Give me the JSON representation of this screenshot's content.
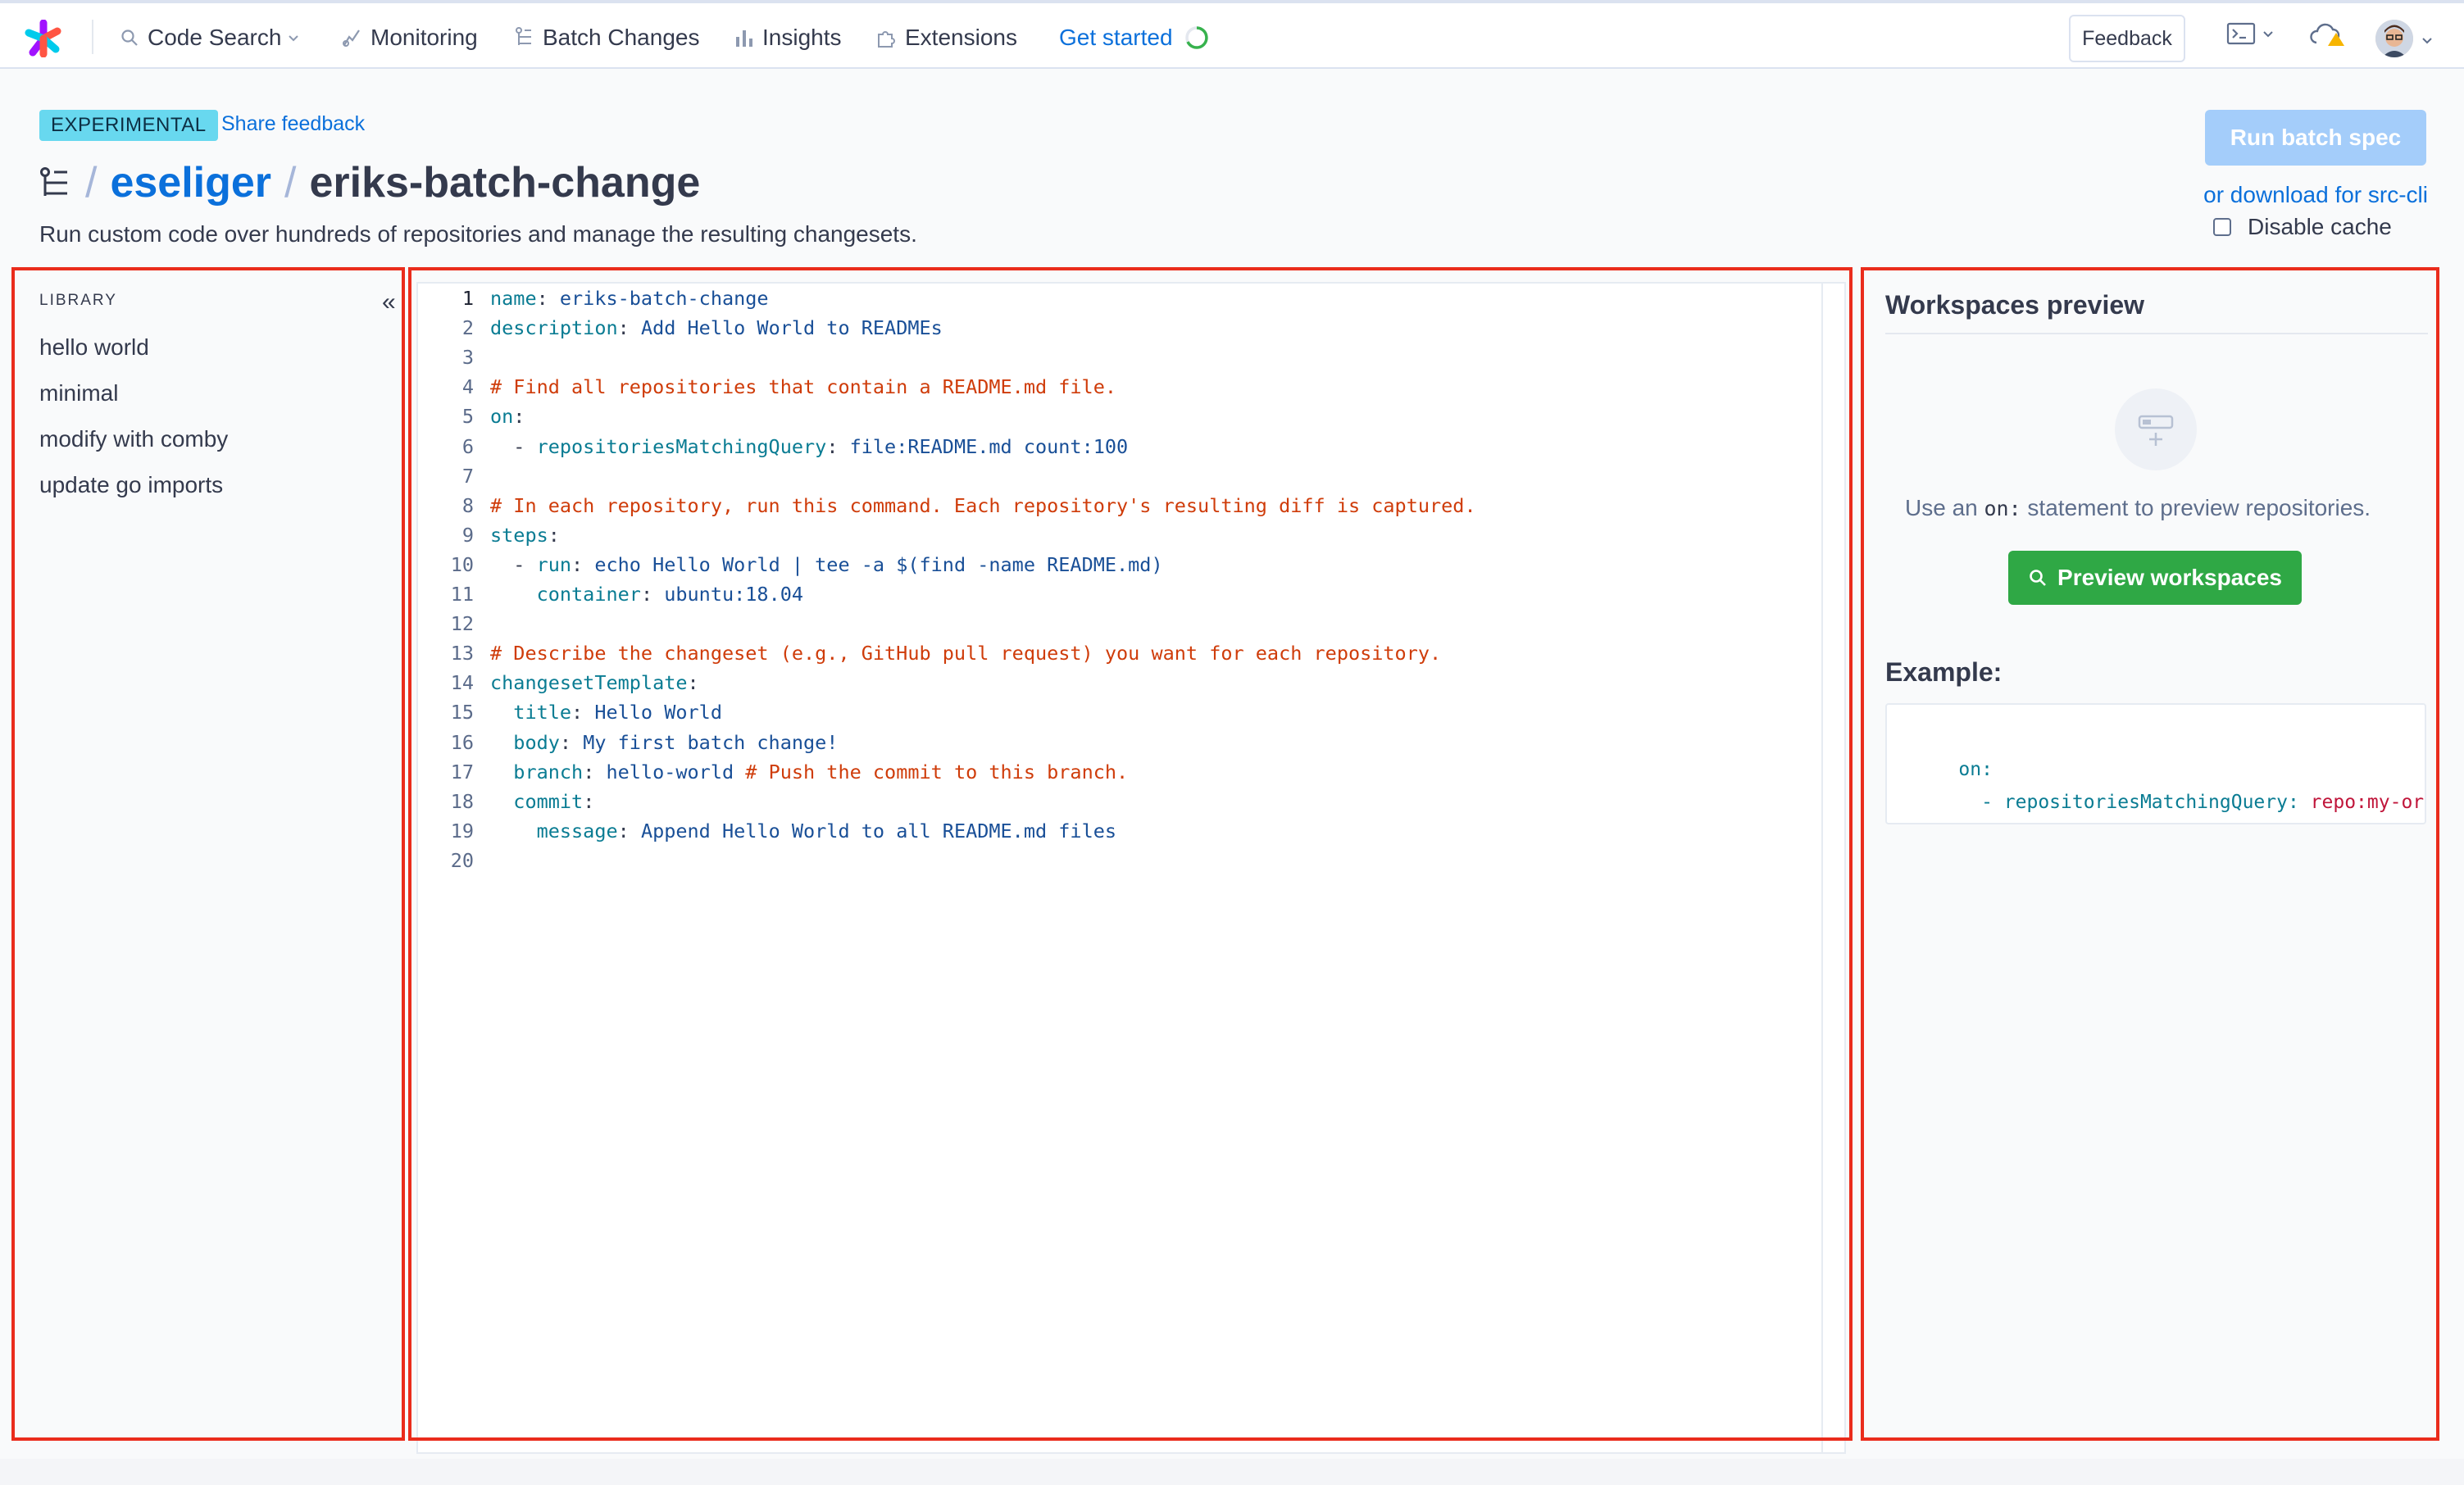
{
  "nav": {
    "items": [
      {
        "label": "Code Search",
        "icon": "search-icon"
      },
      {
        "label": "Monitoring",
        "icon": "monitoring-icon"
      },
      {
        "label": "Batch Changes",
        "icon": "batch-changes-icon"
      },
      {
        "label": "Insights",
        "icon": "insights-icon"
      },
      {
        "label": "Extensions",
        "icon": "puzzle-icon"
      },
      {
        "label": "Get started",
        "icon": "progress-ring-icon"
      }
    ],
    "feedback": "Feedback"
  },
  "header": {
    "badge": "EXPERIMENTAL",
    "share_feedback": "Share feedback",
    "sep": "/",
    "namespace": "eseliger",
    "name": "eriks-batch-change",
    "subtitle": "Run custom code over hundreds of repositories and manage the resulting changesets.",
    "run_button": "Run batch spec",
    "download_link": "or download for src-cli",
    "disable_cache": "Disable cache"
  },
  "library": {
    "title": "LIBRARY",
    "collapse": "«",
    "items": [
      "hello world",
      "minimal",
      "modify with comby",
      "update go imports"
    ]
  },
  "editor": {
    "lines": [
      {
        "n": "1",
        "key": "name",
        "val": "eriks-batch-change"
      },
      {
        "n": "2",
        "key": "description",
        "val": "Add Hello World to READMEs"
      },
      {
        "n": "3"
      },
      {
        "n": "4",
        "comment": "# Find all repositories that contain a README.md file."
      },
      {
        "n": "5",
        "key": "on"
      },
      {
        "n": "6",
        "indent": "  - ",
        "key": "repositoriesMatchingQuery",
        "val": "file:README.md count:100"
      },
      {
        "n": "7"
      },
      {
        "n": "8",
        "comment": "# In each repository, run this command. Each repository's resulting diff is captured."
      },
      {
        "n": "9",
        "key": "steps"
      },
      {
        "n": "10",
        "indent": "  - ",
        "key": "run",
        "val": "echo Hello World | tee -a $(find -name README.md)"
      },
      {
        "n": "11",
        "indent": "    ",
        "key": "container",
        "val": "ubuntu:18.04"
      },
      {
        "n": "12"
      },
      {
        "n": "13",
        "comment": "# Describe the changeset (e.g., GitHub pull request) you want for each repository."
      },
      {
        "n": "14",
        "key": "changesetTemplate"
      },
      {
        "n": "15",
        "indent": "  ",
        "key": "title",
        "val": "Hello World"
      },
      {
        "n": "16",
        "indent": "  ",
        "key": "body",
        "val": "My first batch change!"
      },
      {
        "n": "17",
        "indent": "  ",
        "key": "branch",
        "val": "hello-world",
        "comment": " # Push the commit to this branch."
      },
      {
        "n": "18",
        "indent": "  ",
        "key": "commit"
      },
      {
        "n": "19",
        "indent": "    ",
        "key": "message",
        "val": "Append Hello World to all README.md files"
      },
      {
        "n": "20"
      }
    ]
  },
  "workspaces": {
    "title": "Workspaces preview",
    "hint_before": "Use an ",
    "hint_code": "on:",
    "hint_after": " statement to preview repositories.",
    "preview_button": "Preview workspaces",
    "example_label": "Example:",
    "example_line1_key": "on:",
    "example_line2_dash": "  - ",
    "example_line2_key": "repositoriesMatchingQuery:",
    "example_line2_val": "repo:my-org"
  },
  "colors": {
    "accent": "#0b70db",
    "highlight_outline": "#ea2c1c",
    "primary_button_disabled": "#a4cdfa",
    "success_button": "#2fa845",
    "badge": "#68d8ef"
  }
}
